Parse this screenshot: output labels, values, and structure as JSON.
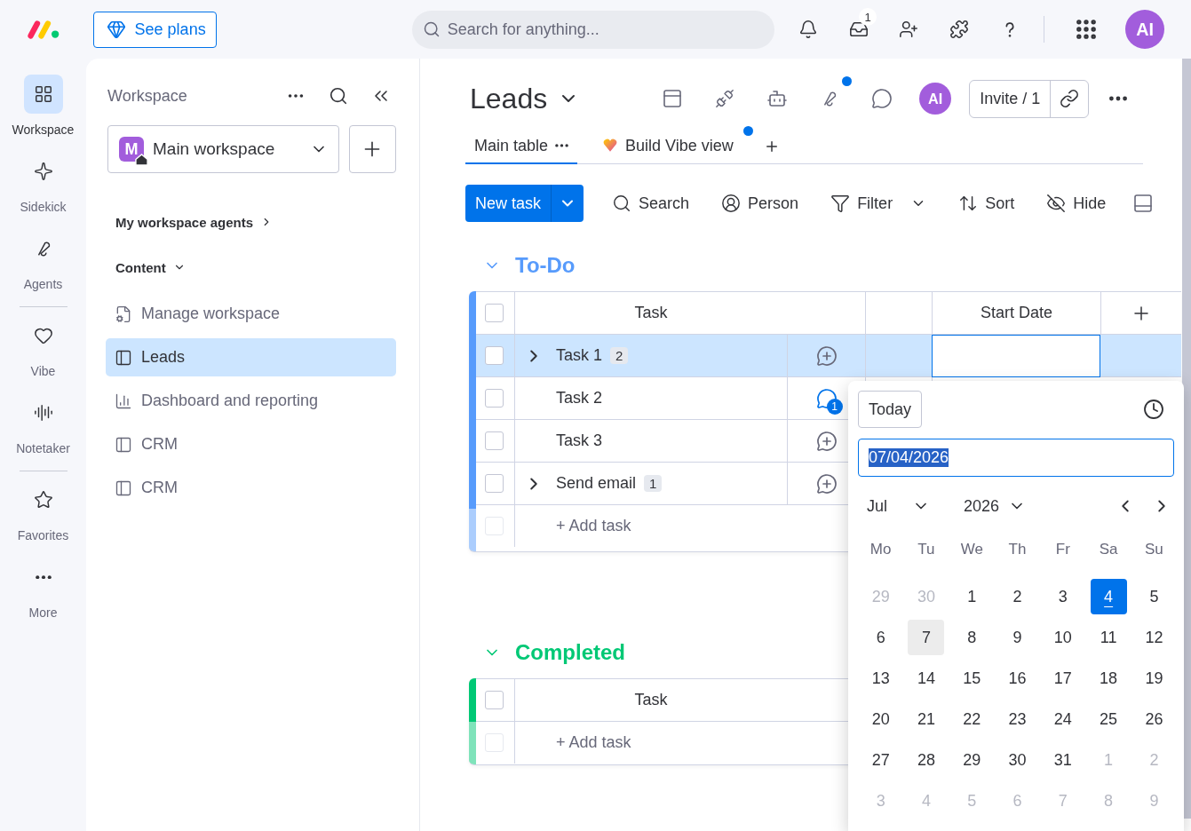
{
  "topbar": {
    "see_plans": "See plans",
    "search": {
      "placeholder": "Search for anything..."
    },
    "inbox_badge": "1",
    "avatar": "AI"
  },
  "rail": {
    "groups": [
      [
        {
          "kind": "workspace",
          "label": "Workspace",
          "selected": true
        },
        {
          "kind": "sidekick",
          "label": "Sidekick",
          "selected": false
        },
        {
          "kind": "agents",
          "label": "Agents",
          "selected": false
        }
      ],
      [
        {
          "kind": "vibe",
          "label": "Vibe",
          "selected": false
        },
        {
          "kind": "notetaker",
          "label": "Notetaker",
          "selected": false
        }
      ],
      [
        {
          "kind": "favorites",
          "label": "Favorites",
          "selected": false
        },
        {
          "kind": "more",
          "label": "More",
          "selected": false
        }
      ]
    ]
  },
  "sidebar": {
    "title": "Workspace",
    "workspace": {
      "initial": "M",
      "name": "Main workspace"
    },
    "agents_link": "My workspace agents",
    "section": "Content",
    "items": [
      {
        "kind": "settings",
        "label": "Manage workspace",
        "selected": false
      },
      {
        "kind": "board",
        "label": "Leads",
        "selected": true
      },
      {
        "kind": "dashboard",
        "label": "Dashboard and reporting",
        "selected": false
      },
      {
        "kind": "board",
        "label": "CRM",
        "selected": false
      },
      {
        "kind": "board",
        "label": "CRM",
        "selected": false
      }
    ]
  },
  "board": {
    "title": "Leads",
    "avatar": "AI",
    "invite": "Invite / 1",
    "agents_dot": true
  },
  "tabs": [
    {
      "kind": "table",
      "label": "Main table",
      "selected": true,
      "dot": false
    },
    {
      "kind": "vibe",
      "label": "Build Vibe view",
      "selected": false,
      "dot": true
    }
  ],
  "toolbar": {
    "new_task": "New task",
    "items": [
      {
        "kind": "search",
        "label": "Search"
      },
      {
        "kind": "person",
        "label": "Person"
      },
      {
        "kind": "filter",
        "label": "Filter"
      },
      {
        "kind": "sort",
        "label": "Sort"
      },
      {
        "kind": "hide",
        "label": "Hide"
      }
    ]
  },
  "groups": [
    {
      "title": "To-Do",
      "color": "#579bfc",
      "expanded": true,
      "all_checked": false,
      "add_checkbox_disabled": true,
      "columns": {
        "task": "Task",
        "date": "Start Date"
      },
      "add_task": "+ Add task",
      "rows": [
        {
          "task": "Task 1",
          "subitems": "2",
          "selected": true,
          "checked": false,
          "date_editing": true
        },
        {
          "task": "Task 2",
          "updates": "1",
          "selected": false,
          "checked": false,
          "date_editing": false
        },
        {
          "task": "Task 3",
          "selected": false,
          "checked": false,
          "date_editing": false
        },
        {
          "task": "Send email",
          "subitems": "1",
          "selected": false,
          "checked": false,
          "date_editing": false
        }
      ]
    },
    {
      "title": "Completed",
      "color": "#00c875",
      "expanded": true,
      "all_checked": false,
      "add_checkbox_disabled": true,
      "columns": {
        "task": "Task"
      },
      "add_task": "+ Add task"
    }
  ],
  "datepicker": {
    "today_button": "Today",
    "value": "07/04/2026",
    "month": "Jul",
    "year": "2026",
    "weekdays": [
      "Mo",
      "Tu",
      "We",
      "Th",
      "Fr",
      "Sa",
      "Su"
    ],
    "weeks": [
      [
        {
          "day": "29",
          "outside": true,
          "selected": false,
          "hovered": false
        },
        {
          "day": "30",
          "outside": true,
          "selected": false,
          "hovered": false
        },
        {
          "day": "1",
          "outside": false,
          "selected": false,
          "hovered": false
        },
        {
          "day": "2",
          "outside": false,
          "selected": false,
          "hovered": false
        },
        {
          "day": "3",
          "outside": false,
          "selected": false,
          "hovered": false
        },
        {
          "day": "4",
          "outside": false,
          "selected": true,
          "hovered": false
        },
        {
          "day": "5",
          "outside": false,
          "selected": false,
          "hovered": false
        }
      ],
      [
        {
          "day": "6",
          "outside": false,
          "selected": false,
          "hovered": false
        },
        {
          "day": "7",
          "outside": false,
          "selected": false,
          "hovered": true
        },
        {
          "day": "8",
          "outside": false,
          "selected": false,
          "hovered": false
        },
        {
          "day": "9",
          "outside": false,
          "selected": false,
          "hovered": false
        },
        {
          "day": "10",
          "outside": false,
          "selected": false,
          "hovered": false
        },
        {
          "day": "11",
          "outside": false,
          "selected": false,
          "hovered": false
        },
        {
          "day": "12",
          "outside": false,
          "selected": false,
          "hovered": false
        }
      ],
      [
        {
          "day": "13",
          "outside": false,
          "selected": false,
          "hovered": false
        },
        {
          "day": "14",
          "outside": false,
          "selected": false,
          "hovered": false
        },
        {
          "day": "15",
          "outside": false,
          "selected": false,
          "hovered": false
        },
        {
          "day": "16",
          "outside": false,
          "selected": false,
          "hovered": false
        },
        {
          "day": "17",
          "outside": false,
          "selected": false,
          "hovered": false
        },
        {
          "day": "18",
          "outside": false,
          "selected": false,
          "hovered": false
        },
        {
          "day": "19",
          "outside": false,
          "selected": false,
          "hovered": false
        }
      ],
      [
        {
          "day": "20",
          "outside": false,
          "selected": false,
          "hovered": false
        },
        {
          "day": "21",
          "outside": false,
          "selected": false,
          "hovered": false
        },
        {
          "day": "22",
          "outside": false,
          "selected": false,
          "hovered": false
        },
        {
          "day": "23",
          "outside": false,
          "selected": false,
          "hovered": false
        },
        {
          "day": "24",
          "outside": false,
          "selected": false,
          "hovered": false
        },
        {
          "day": "25",
          "outside": false,
          "selected": false,
          "hovered": false
        },
        {
          "day": "26",
          "outside": false,
          "selected": false,
          "hovered": false
        }
      ],
      [
        {
          "day": "27",
          "outside": false,
          "selected": false,
          "hovered": false
        },
        {
          "day": "28",
          "outside": false,
          "selected": false,
          "hovered": false
        },
        {
          "day": "29",
          "outside": false,
          "selected": false,
          "hovered": false
        },
        {
          "day": "30",
          "outside": false,
          "selected": false,
          "hovered": false
        },
        {
          "day": "31",
          "outside": false,
          "selected": false,
          "hovered": false
        },
        {
          "day": "1",
          "outside": true,
          "selected": false,
          "hovered": false
        },
        {
          "day": "2",
          "outside": true,
          "selected": false,
          "hovered": false
        }
      ],
      [
        {
          "day": "3",
          "outside": true,
          "selected": false,
          "hovered": false
        },
        {
          "day": "4",
          "outside": true,
          "selected": false,
          "hovered": false
        },
        {
          "day": "5",
          "outside": true,
          "selected": false,
          "hovered": false
        },
        {
          "day": "6",
          "outside": true,
          "selected": false,
          "hovered": false
        },
        {
          "day": "7",
          "outside": true,
          "selected": false,
          "hovered": false
        },
        {
          "day": "8",
          "outside": true,
          "selected": false,
          "hovered": false
        },
        {
          "day": "9",
          "outside": true,
          "selected": false,
          "hovered": false
        }
      ]
    ]
  }
}
